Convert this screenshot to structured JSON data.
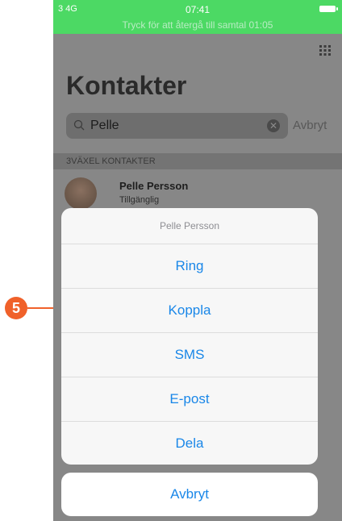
{
  "status_bar": {
    "carrier": "3  4G",
    "time": "07:41",
    "call_return": "Tryck för att återgå till samtal 01:05"
  },
  "page": {
    "title": "Kontakter",
    "search_value": "Pelle",
    "cancel_label": "Avbryt",
    "section_header": "3VÄXEL KONTAKTER"
  },
  "contact": {
    "name": "Pelle Persson",
    "status": "Tillgänglig"
  },
  "action_sheet": {
    "title": "Pelle Persson",
    "items": [
      "Ring",
      "Koppla",
      "SMS",
      "E-post",
      "Dela"
    ],
    "cancel": "Avbryt"
  },
  "callout": {
    "number": "5"
  },
  "colors": {
    "accent": "#1a87e8",
    "call_bar": "#4cd964",
    "callout": "#f0612a"
  }
}
